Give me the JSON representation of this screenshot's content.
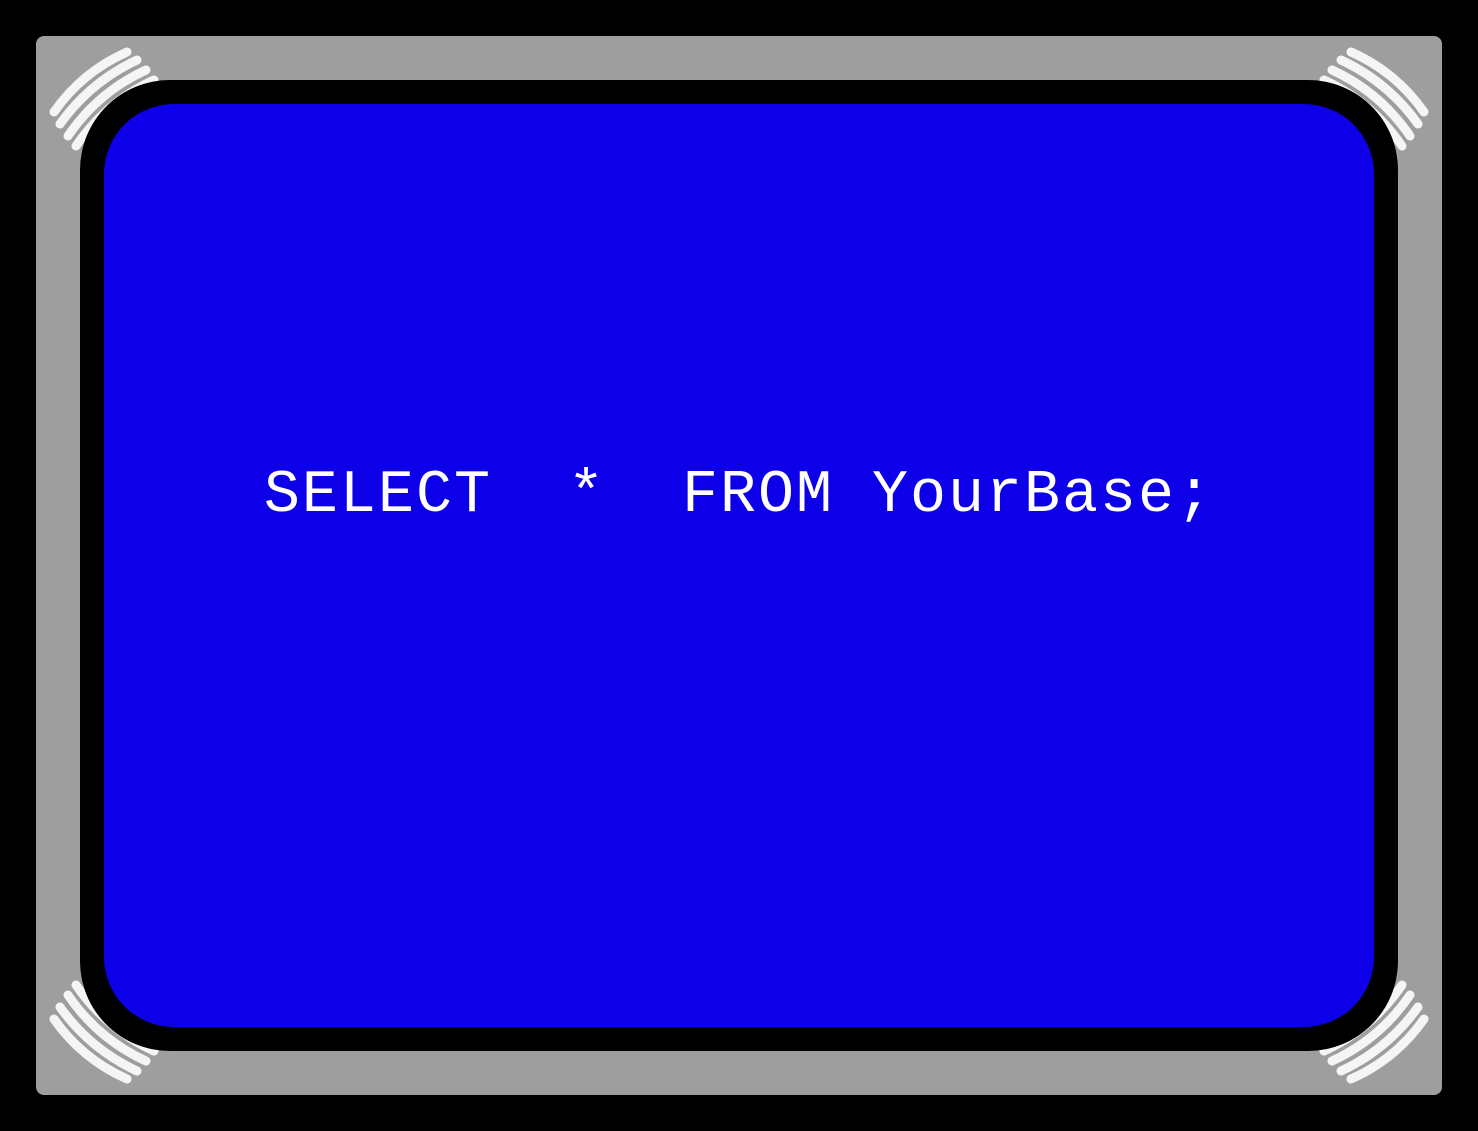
{
  "screen": {
    "text": "SELECT  *  FROM YourBase;",
    "text_color": "#ffffff",
    "background_color": "#0d00e8"
  },
  "monitor": {
    "outer_frame_color": "#000000",
    "bezel_color": "#9e9e9e",
    "inner_border_color": "#000000",
    "glare_color": "#ffffff"
  }
}
